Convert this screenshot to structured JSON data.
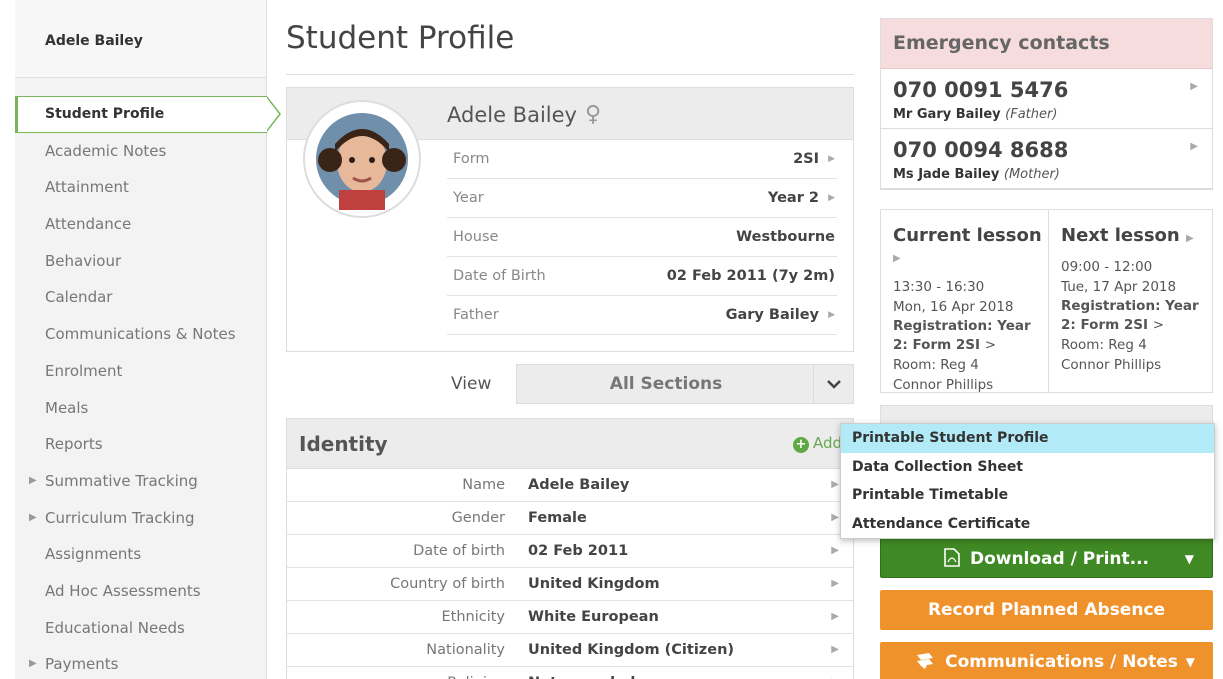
{
  "sidebar": {
    "user_name": "Adele Bailey",
    "items": [
      {
        "label": "Student Profile",
        "active": true,
        "expandable": false
      },
      {
        "label": "Academic Notes",
        "expandable": false
      },
      {
        "label": "Attainment",
        "expandable": false
      },
      {
        "label": "Attendance",
        "expandable": false
      },
      {
        "label": "Behaviour",
        "expandable": false
      },
      {
        "label": "Calendar",
        "expandable": false
      },
      {
        "label": "Communications & Notes",
        "expandable": false
      },
      {
        "label": "Enrolment",
        "expandable": false
      },
      {
        "label": "Meals",
        "expandable": false
      },
      {
        "label": "Reports",
        "expandable": false
      },
      {
        "label": "Summative Tracking",
        "expandable": true
      },
      {
        "label": "Curriculum Tracking",
        "expandable": true
      },
      {
        "label": "Assignments",
        "expandable": false
      },
      {
        "label": "Ad Hoc Assessments",
        "expandable": false
      },
      {
        "label": "Educational Needs",
        "expandable": false
      },
      {
        "label": "Payments",
        "expandable": true
      }
    ]
  },
  "page": {
    "title": "Student Profile"
  },
  "profile": {
    "name": "Adele Bailey",
    "gender_icon": "female-symbol-icon",
    "gender_glyph": "♀",
    "rows": [
      {
        "label": "Form",
        "value": "2SI",
        "link": true
      },
      {
        "label": "Year",
        "value": "Year 2",
        "link": true
      },
      {
        "label": "House",
        "value": "Westbourne",
        "link": false
      },
      {
        "label": "Date of Birth",
        "value": "02 Feb 2011 (7y 2m)",
        "link": false
      },
      {
        "label": "Father",
        "value": "Gary Bailey",
        "link": true
      }
    ]
  },
  "view": {
    "label": "View",
    "selected": "All Sections"
  },
  "identity": {
    "title": "Identity",
    "add_label": "Add",
    "rows": [
      {
        "label": "Name",
        "value": "Adele Bailey"
      },
      {
        "label": "Gender",
        "value": "Female"
      },
      {
        "label": "Date of birth",
        "value": "02 Feb 2011"
      },
      {
        "label": "Country of birth",
        "value": "United Kingdom"
      },
      {
        "label": "Ethnicity",
        "value": "White European"
      },
      {
        "label": "Nationality",
        "value": "United Kingdom (Citizen)"
      },
      {
        "label": "Religion",
        "value": "Not recorded"
      }
    ]
  },
  "emergency": {
    "title": "Emergency contacts",
    "contacts": [
      {
        "number": "070 0091 5476",
        "name": "Mr Gary Bailey",
        "relation": "(Father)"
      },
      {
        "number": "070 0094 8688",
        "name": "Ms Jade Bailey",
        "relation": "(Mother)"
      }
    ]
  },
  "lessons": {
    "current": {
      "title": "Current lesson",
      "time": "13:30 - 16:30",
      "date": "Mon, 16 Apr 2018",
      "registration": "Registration: Year 2: Form 2SI",
      "room": "Room: Reg 4",
      "teacher": "Connor Phillips"
    },
    "next": {
      "title": "Next lesson",
      "time": "09:00 - 12:00",
      "date": "Tue, 17 Apr 2018",
      "registration": "Registration: Year 2: Form 2SI",
      "room": "Room: Reg 4",
      "teacher": "Connor Phillips"
    }
  },
  "print_menu": {
    "items": [
      {
        "label": "Printable Student Profile",
        "highlighted": true
      },
      {
        "label": "Data Collection Sheet"
      },
      {
        "label": "Printable Timetable"
      },
      {
        "label": "Attendance Certificate"
      }
    ]
  },
  "buttons": {
    "download": "Download / Print...",
    "absence": "Record Planned Absence",
    "comms": "Communications / Notes"
  },
  "colors": {
    "active_green": "#7ab55c",
    "download_green": "#3f8a24",
    "orange": "#f0922c",
    "emergency_pink": "#f6dcdc",
    "menu_highlight": "#b3eaf7"
  }
}
